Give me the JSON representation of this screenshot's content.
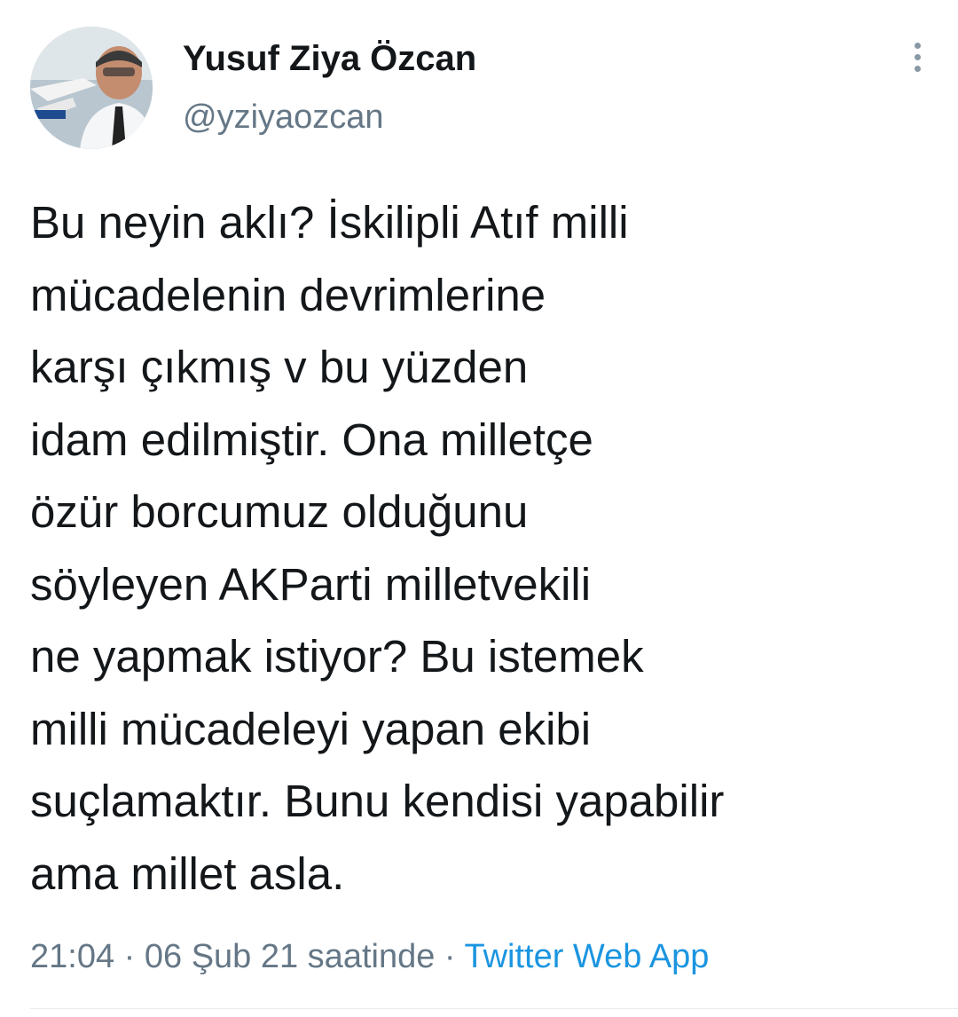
{
  "author": {
    "display_name": "Yusuf Ziya Özcan",
    "handle": "@yziyaozcan"
  },
  "tweet": {
    "lines": [
      "Bu neyin aklı? İskilipli Atıf milli",
      "mücadelenin devrimlerine",
      "karşı çıkmış v bu yüzden",
      "idam edilmiştir. Ona milletçe",
      "özür borcumuz olduğunu",
      "söyleyen AKParti milletvekili",
      "ne yapmak istiyor? Bu istemek",
      "milli mücadeleyi yapan ekibi",
      "suçlamaktır. Bunu kendisi yapabilir",
      "ama millet asla."
    ]
  },
  "meta": {
    "timestamp": "21:04 · 06 Şub 21 saatinde",
    "separator": " · ",
    "source": "Twitter Web App"
  },
  "icons": {
    "more": "more-vertical-icon"
  },
  "colors": {
    "text": "#14171a",
    "secondary": "#657786",
    "link": "#1b95e0"
  }
}
